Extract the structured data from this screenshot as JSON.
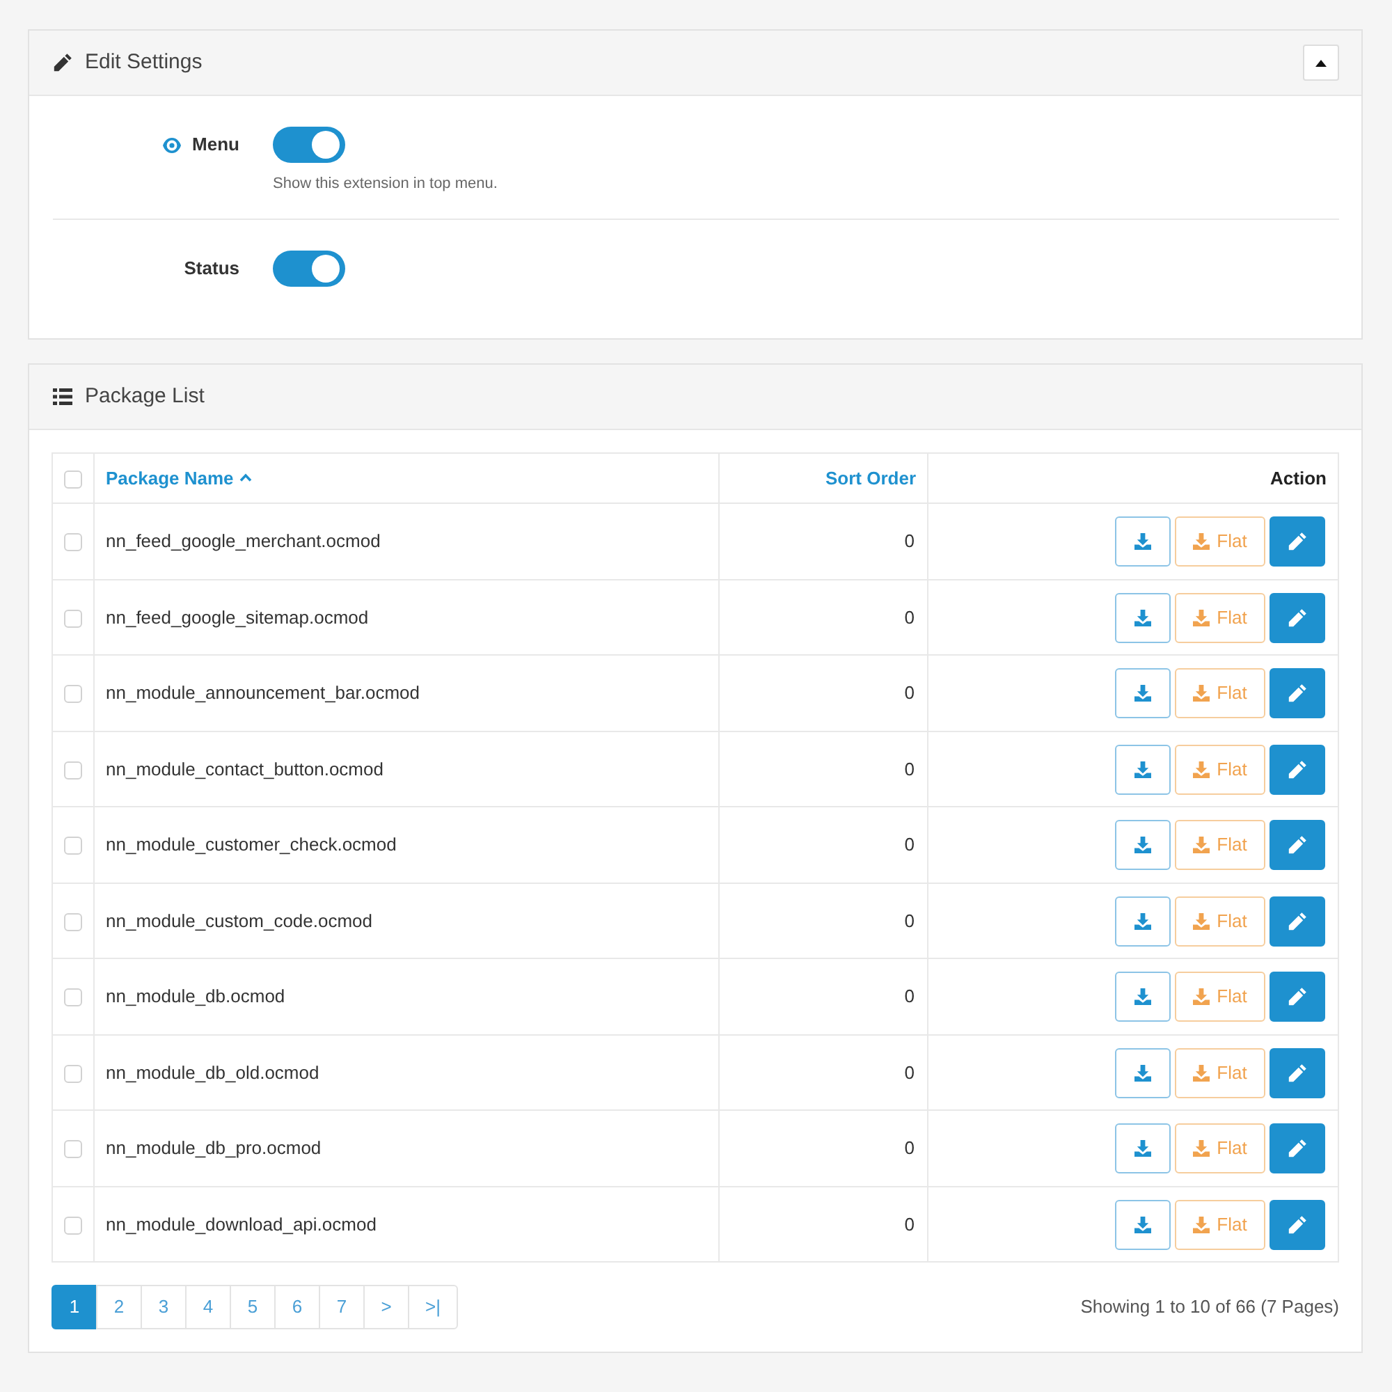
{
  "settings": {
    "title": "Edit Settings",
    "expanded": true,
    "fields": [
      {
        "label": "Menu",
        "help_icon": true,
        "on": true,
        "help": "Show this extension in top menu."
      },
      {
        "label": "Status",
        "help_icon": false,
        "on": true
      }
    ]
  },
  "packages": {
    "title": "Package List",
    "table": {
      "select_all_checked": false,
      "columns": [
        {
          "label": "Package Name",
          "sortable": true,
          "sorted": true
        },
        {
          "label": "Sort Order",
          "sortable": true,
          "sorted": false
        },
        {
          "label": "Action",
          "sortable": false,
          "sorted": false
        }
      ],
      "rows": [
        {
          "checked": false,
          "name": "nn_feed_google_merchant.ocmod",
          "sort_order": "0",
          "flat_button": "Flat"
        },
        {
          "checked": false,
          "name": "nn_feed_google_sitemap.ocmod",
          "sort_order": "0",
          "flat_button": "Flat"
        },
        {
          "checked": false,
          "name": "nn_module_announcement_bar.ocmod",
          "sort_order": "0",
          "flat_button": "Flat"
        },
        {
          "checked": false,
          "name": "nn_module_contact_button.ocmod",
          "sort_order": "0",
          "flat_button": "Flat"
        },
        {
          "checked": false,
          "name": "nn_module_customer_check.ocmod",
          "sort_order": "0",
          "flat_button": "Flat"
        },
        {
          "checked": false,
          "name": "nn_module_custom_code.ocmod",
          "sort_order": "0",
          "flat_button": "Flat"
        },
        {
          "checked": false,
          "name": "nn_module_db.ocmod",
          "sort_order": "0",
          "flat_button": "Flat"
        },
        {
          "checked": false,
          "name": "nn_module_db_old.ocmod",
          "sort_order": "0",
          "flat_button": "Flat"
        },
        {
          "checked": false,
          "name": "nn_module_db_pro.ocmod",
          "sort_order": "0",
          "flat_button": "Flat"
        },
        {
          "checked": false,
          "name": "nn_module_download_api.ocmod",
          "sort_order": "0",
          "flat_button": "Flat"
        }
      ]
    },
    "pagination": {
      "pages": [
        {
          "label": "1",
          "selected": true
        },
        {
          "label": "2",
          "selected": false
        },
        {
          "label": "3",
          "selected": false
        },
        {
          "label": "4",
          "selected": false
        },
        {
          "label": "5",
          "selected": false
        },
        {
          "label": "6",
          "selected": false
        },
        {
          "label": "7",
          "selected": false
        },
        {
          "label": ">",
          "selected": false
        },
        {
          "label": ">|",
          "selected": false
        }
      ],
      "summary": "Showing 1 to 10 of 66 (7 Pages)"
    }
  }
}
